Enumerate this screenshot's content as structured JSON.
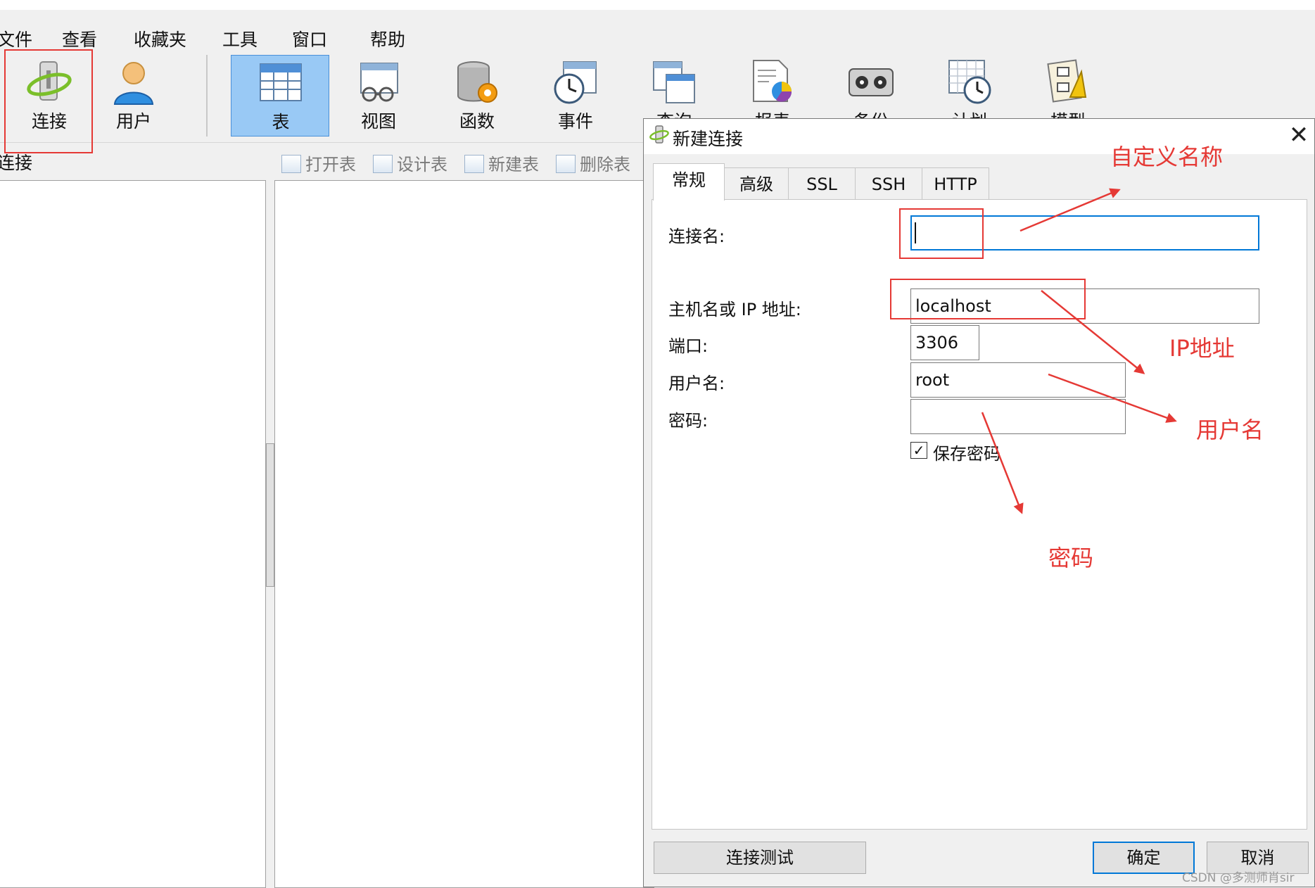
{
  "menubar": {
    "items": [
      "文件",
      "查看",
      "收藏夹",
      "工具",
      "窗口",
      "帮助"
    ]
  },
  "toolbar": {
    "tools": [
      {
        "label": "连接",
        "icon": "connection-icon"
      },
      {
        "label": "用户",
        "icon": "user-icon"
      },
      {
        "label": "表",
        "icon": "table-icon",
        "selected": true
      },
      {
        "label": "视图",
        "icon": "view-icon"
      },
      {
        "label": "函数",
        "icon": "function-icon"
      },
      {
        "label": "事件",
        "icon": "event-icon"
      },
      {
        "label": "查询",
        "icon": "query-icon"
      },
      {
        "label": "报表",
        "icon": "report-icon"
      },
      {
        "label": "备份",
        "icon": "backup-icon"
      },
      {
        "label": "计划",
        "icon": "schedule-icon"
      },
      {
        "label": "模型",
        "icon": "model-icon"
      }
    ]
  },
  "connection_panel": {
    "title": "连接"
  },
  "object_toolbar": {
    "open_table": "打开表",
    "design_table": "设计表",
    "new_table": "新建表",
    "delete_table": "删除表"
  },
  "dialog": {
    "title": "新建连接",
    "close_glyph": "✕",
    "tabs": [
      "常规",
      "高级",
      "SSL",
      "SSH",
      "HTTP"
    ],
    "active_tab": "常规",
    "fields": {
      "connection_name_label": "连接名:",
      "connection_name_value": "",
      "host_label": "主机名或 IP 地址:",
      "host_value": "localhost",
      "port_label": "端口:",
      "port_value": "3306",
      "username_label": "用户名:",
      "username_value": "root",
      "password_label": "密码:",
      "password_value": ""
    },
    "save_password": {
      "label": "保存密码",
      "checked": true,
      "check_glyph": "✓"
    },
    "buttons": {
      "test": "连接测试",
      "ok": "确定",
      "cancel": "取消"
    }
  },
  "annotations": {
    "custom_name": "自定义名称",
    "ip_address": "IP地址",
    "username": "用户名",
    "password": "密码",
    "color": "#e53935"
  },
  "watermark": "CSDN @多测师肖sir"
}
